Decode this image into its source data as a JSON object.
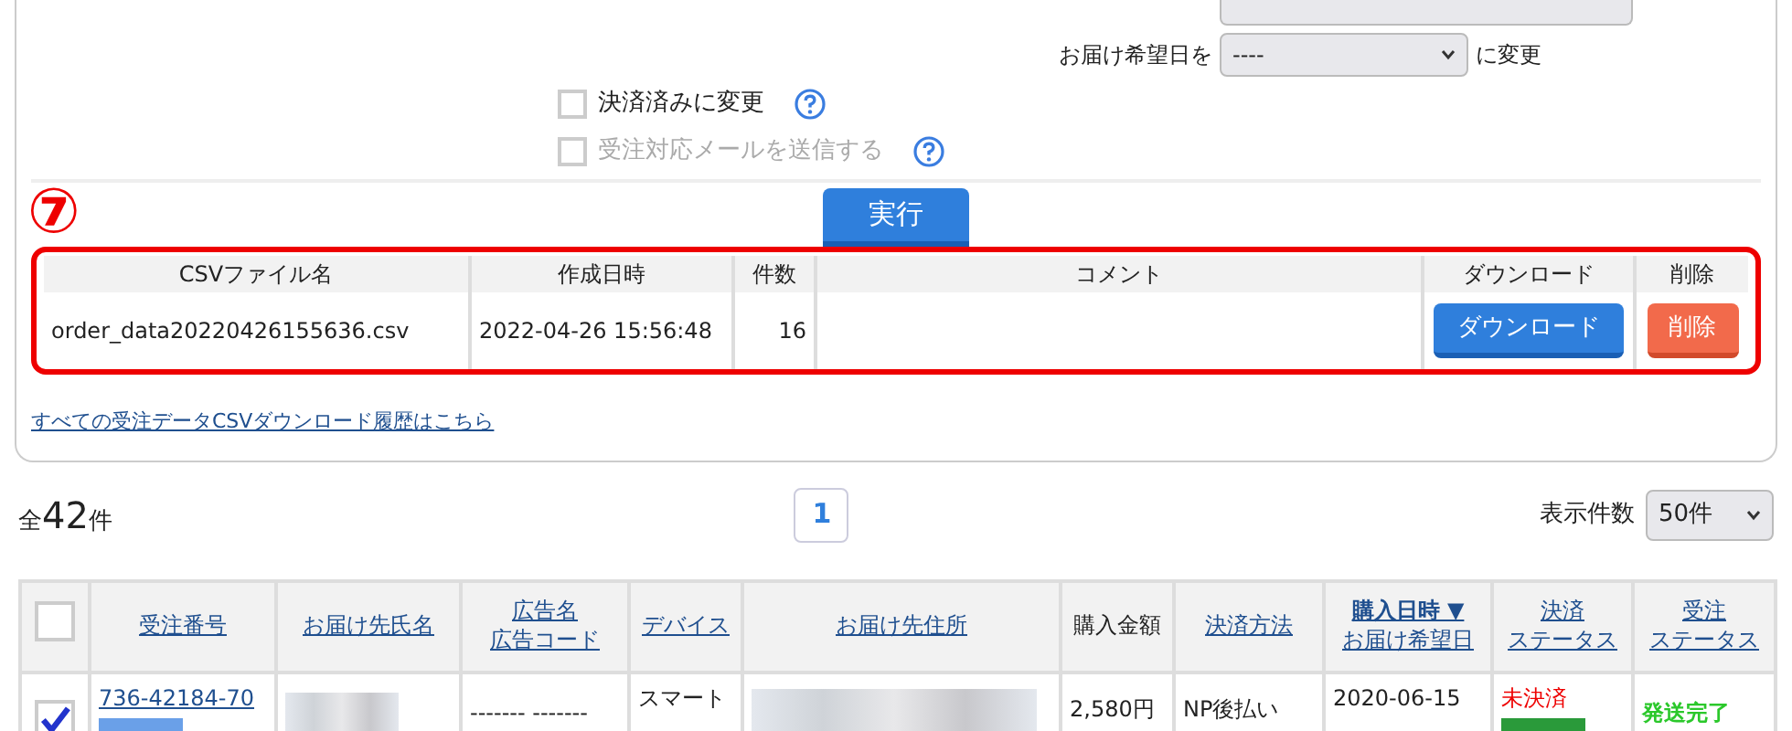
{
  "delivery_date": {
    "label": "お届け希望日を",
    "value": "----",
    "suffix": "に変更"
  },
  "options": [
    {
      "label": "決済済みに変更",
      "checked": false,
      "disabled": false
    },
    {
      "label": "受注対応メールを送信する",
      "checked": false,
      "disabled": true
    }
  ],
  "annotation": "⑦",
  "execute_button": "実行",
  "csv_table": {
    "columns": [
      "CSVファイル名",
      "作成日時",
      "件数",
      "コメント",
      "ダウンロード",
      "削除"
    ],
    "rows": [
      {
        "file": "order_data20220426155636.csv",
        "created": "2022-04-26 15:56:48",
        "count": "16",
        "download": "ダウンロード",
        "delete": "削除"
      }
    ]
  },
  "history_link": "すべての受注データCSVダウンロード履歴はこちら",
  "total": {
    "prefix": "全",
    "count": "42",
    "suffix": "件"
  },
  "pages": [
    {
      "label": "1",
      "selected": true
    }
  ],
  "per_page": {
    "label": "表示件数",
    "value": "50件"
  },
  "orders": {
    "select_all_checked": false,
    "columns": [
      {
        "lines": [
          "受注番号"
        ],
        "link": true,
        "sorted": false
      },
      {
        "lines": [
          "お届け先氏名"
        ],
        "link": true,
        "sorted": false
      },
      {
        "lines": [
          "広告名",
          "広告コード"
        ],
        "link": true,
        "sorted": false
      },
      {
        "lines": [
          "デバイス"
        ],
        "link": true,
        "sorted": false
      },
      {
        "lines": [
          "お届け先住所"
        ],
        "link": true,
        "sorted": false
      },
      {
        "lines": [
          "購入金額"
        ],
        "link": false,
        "sorted": false
      },
      {
        "lines": [
          "決済方法"
        ],
        "link": true,
        "sorted": false
      },
      {
        "lines": [
          "購入日時 ▼",
          "お届け希望日"
        ],
        "link": true,
        "sorted": true
      },
      {
        "lines": [
          "決済",
          "ステータス"
        ],
        "link": true,
        "sorted": false
      },
      {
        "lines": [
          "受注",
          "ステータス"
        ],
        "link": true,
        "sorted": false
      }
    ],
    "rows": [
      {
        "checked": true,
        "order_no": "736-42184-70",
        "ad": "------- -------",
        "device": "スマート",
        "amount": "2,580円",
        "payment_method": "NP後払い",
        "date": "2020-06-15",
        "payment_status": "未決済",
        "order_status": "発送完了"
      }
    ]
  }
}
